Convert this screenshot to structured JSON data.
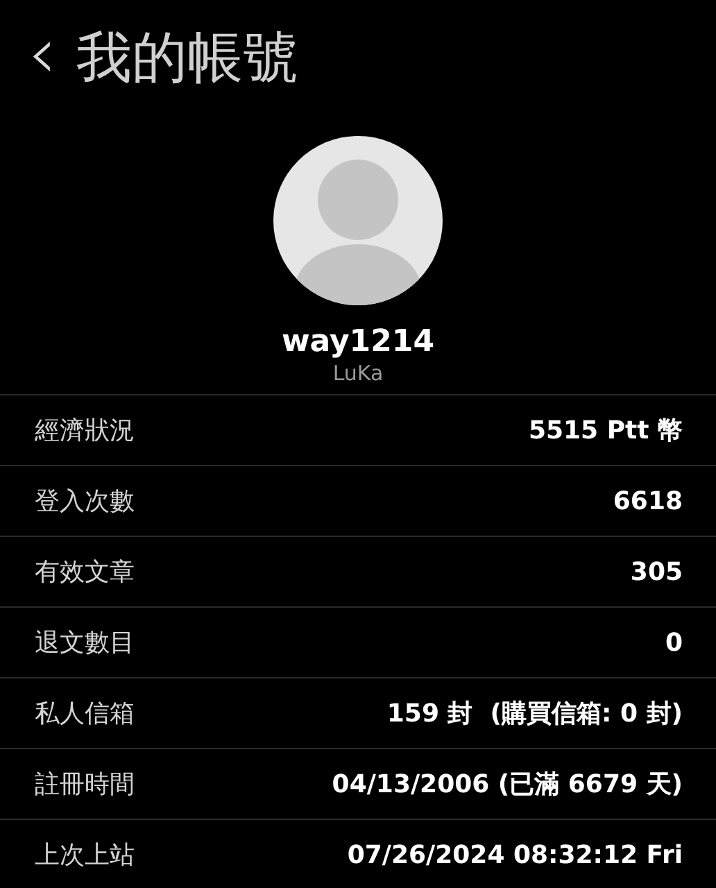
{
  "header": {
    "back_icon": "‹",
    "title": "我的帳號"
  },
  "profile": {
    "username": "way1214",
    "nickname": "LuKa"
  },
  "rows": [
    {
      "label": "經濟狀況",
      "value": "5515 Ptt 幣"
    },
    {
      "label": "登入次數",
      "value": "6618"
    },
    {
      "label": "有效文章",
      "value": "305"
    },
    {
      "label": "退文數目",
      "value": "0"
    },
    {
      "label": "私人信箱",
      "value": "159 封  (購買信箱: 0 封)"
    },
    {
      "label": "註冊時間",
      "value": "04/13/2006 (已滿 6679 天)"
    },
    {
      "label": "上次上站",
      "value": "07/26/2024 08:32:12 Fri"
    }
  ]
}
